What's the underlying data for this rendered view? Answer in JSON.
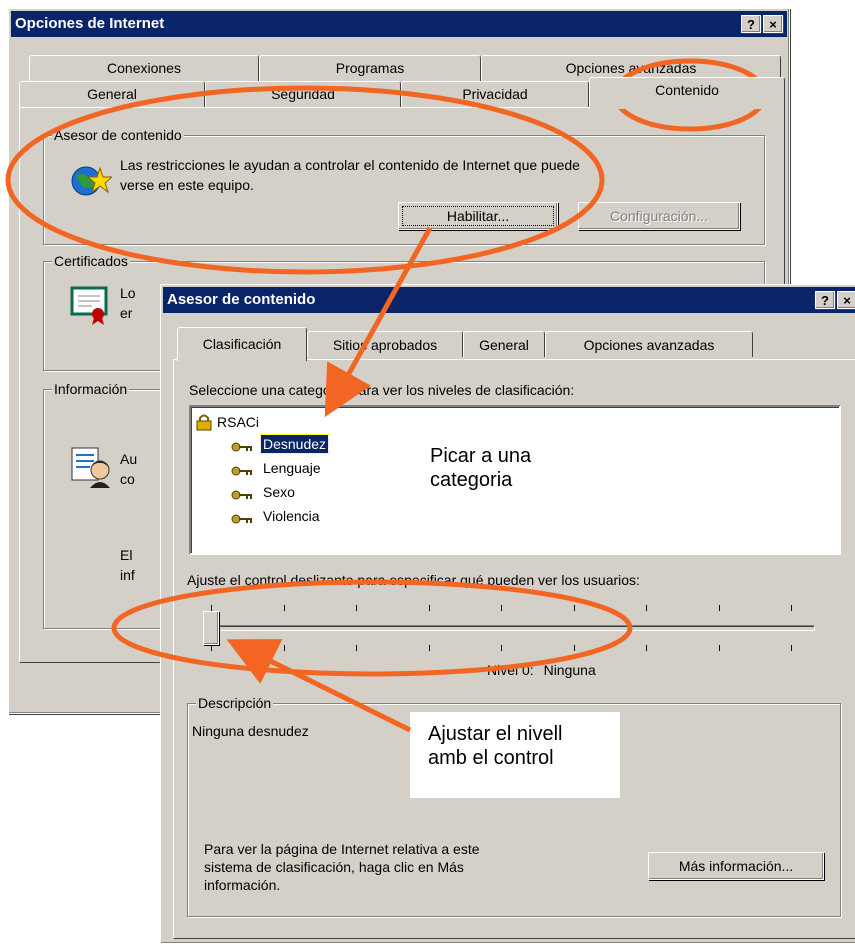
{
  "back_window": {
    "title": "Opciones de Internet",
    "help_btn": "?",
    "close_btn": "×",
    "tabs_row1": [
      "Conexiones",
      "Programas",
      "Opciones avanzadas"
    ],
    "tabs_row2": [
      "General",
      "Seguridad",
      "Privacidad",
      "Contenido"
    ],
    "content_advisor": {
      "label": "Asesor de contenido",
      "text_line1": "Las restricciones le ayudan a controlar el contenido de Internet que puede",
      "text_line2": "verse en este equipo.",
      "enable_btn": "Habilitar...",
      "settings_btn": "Configuración..."
    },
    "certificates": {
      "label": "Certificados",
      "text_line1": "Lo",
      "text_line2": "er"
    },
    "info": {
      "label": "Información",
      "text1_line1": "Au",
      "text1_line2": "co",
      "text2_line1": "El",
      "text2_line2": "inf"
    }
  },
  "front_window": {
    "title": "Asesor de contenido",
    "help_btn": "?",
    "close_btn": "×",
    "tabs": [
      "Clasificación",
      "Sitios aprobados",
      "General",
      "Opciones avanzadas"
    ],
    "category_prompt": "Seleccione una categoría para ver los niveles de clasificación:",
    "tree": {
      "root": "RSACi",
      "items": [
        "Desnudez",
        "Lenguaje",
        "Sexo",
        "Violencia"
      ],
      "selected": "Desnudez"
    },
    "slider_prompt": "Ajuste el control deslizante para especificar qué pueden ver los usuarios:",
    "slider": {
      "level": 0,
      "max": 4
    },
    "level_label": "Nivel 0:",
    "level_value": "Ninguna",
    "description": {
      "label": "Descripción",
      "text": "Ninguna desnudez",
      "info_line1": "Para ver la página de Internet relativa a este",
      "info_line2": "sistema de clasificación, haga clic en Más",
      "info_line3": "información.",
      "more_btn": "Más información..."
    }
  },
  "callouts": {
    "pick": "Picar a una categoria",
    "adjust_line1": "Ajustar el nivell",
    "adjust_line2": "amb el control"
  },
  "annotation_color": "#f26522",
  "titlebar_color": "#0a246a"
}
